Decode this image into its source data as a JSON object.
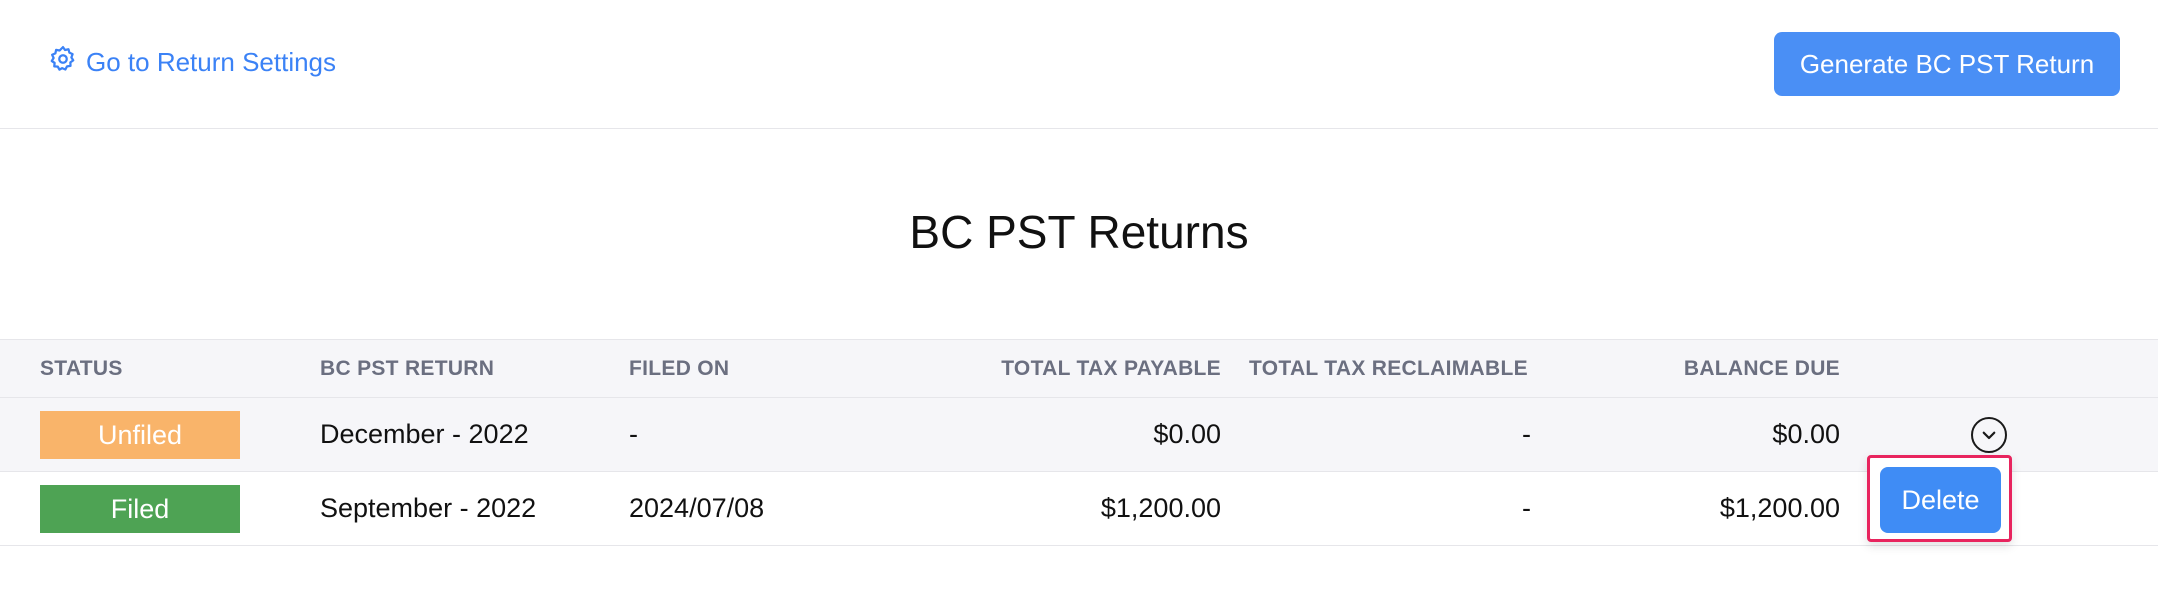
{
  "header": {
    "settings_link": "Go to Return Settings",
    "generate_button": "Generate BC PST Return"
  },
  "page_title": "BC PST Returns",
  "table": {
    "columns": [
      "STATUS",
      "BC PST RETURN",
      "FILED ON",
      "TOTAL TAX PAYABLE",
      "TOTAL TAX RECLAIMABLE",
      "BALANCE DUE"
    ],
    "rows": [
      {
        "status": "Unfiled",
        "period": "December - 2022",
        "filed_on": "-",
        "tax_payable": "$0.00",
        "tax_reclaimable": "-",
        "balance_due": "$0.00"
      },
      {
        "status": "Filed",
        "period": "September - 2022",
        "filed_on": "2024/07/08",
        "tax_payable": "$1,200.00",
        "tax_reclaimable": "-",
        "balance_due": "$1,200.00"
      }
    ]
  },
  "row_menu": {
    "delete_label": "Delete"
  },
  "colors": {
    "accent": "#4a8ff5",
    "unfiled": "#f9b46a",
    "filed": "#4ea354",
    "highlight": "#e8245e"
  },
  "icons": {
    "settings": "gear-icon",
    "row_actions": "chevron-down-circle-icon"
  }
}
